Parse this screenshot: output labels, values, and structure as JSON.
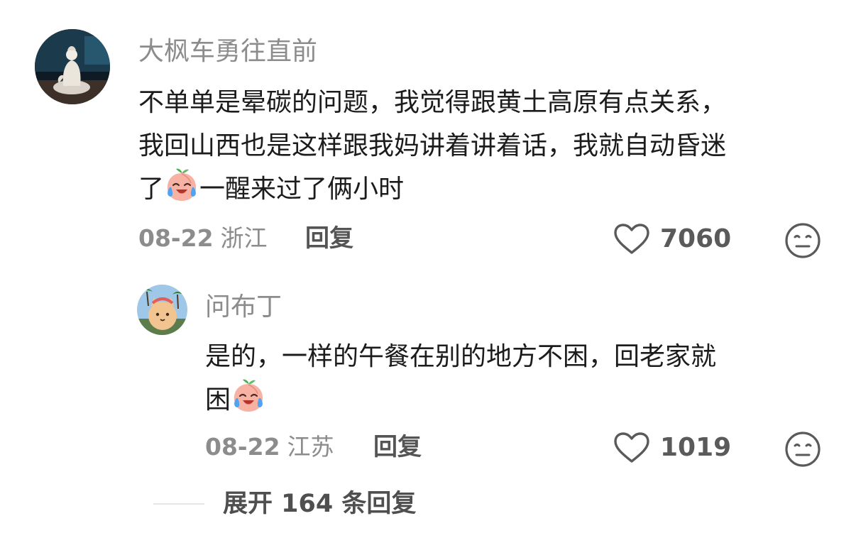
{
  "comments": [
    {
      "username": "大枫车勇往直前",
      "lines": [
        "不单单是晕碳的问题，我觉得跟黄土高原有点关系，",
        "我回山西也是这样跟我妈讲着讲着话，我就自动昏迷",
        "了"
      ],
      "line3_after_emoji": "一醒来过了俩小时",
      "date": "08-22",
      "location": "浙江",
      "reply_label": "回复",
      "likes": "7060",
      "emoji_icon": "crying-laughing-peach-emoji"
    },
    {
      "username": "问布丁",
      "lines": [
        "是的，一样的午餐在别的地方不困，回老家就",
        "困"
      ],
      "date": "08-22",
      "location": "江苏",
      "reply_label": "回复",
      "likes": "1019",
      "emoji_icon": "crying-laughing-peach-emoji"
    }
  ],
  "expand_replies": {
    "label": "展开 164 条回复"
  },
  "colors": {
    "username": "#8c8c8c",
    "content": "#1c1c1c",
    "meta": "#8c8c8c",
    "reply": "#545454",
    "icon": "#5a5a5a"
  }
}
